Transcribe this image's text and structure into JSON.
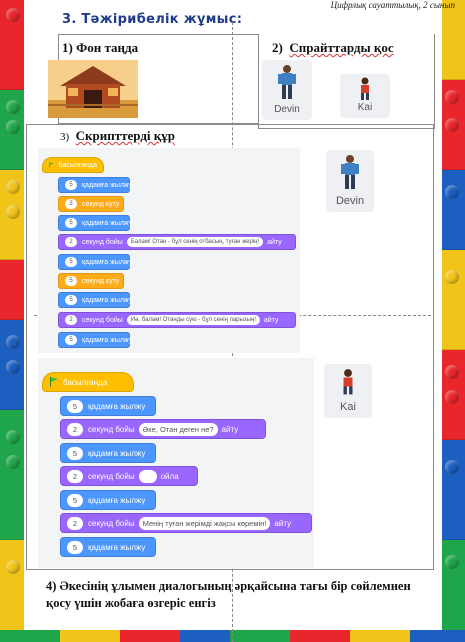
{
  "header_note": "Цифрлық сауаттылық, 2 сынып",
  "section_title": "3. Тәжірибелік жұмыс:",
  "step1": {
    "num": "1)",
    "title": "Фон таңда"
  },
  "step2": {
    "num": "2)",
    "title": "Спрайттарды қос",
    "sprites": [
      "Devin",
      "Kai"
    ]
  },
  "step3": {
    "num": "3)",
    "title": "Скрипттерді құр"
  },
  "script1": {
    "sprite_name": "Devin",
    "hat": "басылғанда",
    "blocks": [
      {
        "color": "blue",
        "num": "5",
        "text": "қадамға жылжу"
      },
      {
        "color": "yellow",
        "num": "3",
        "text": "секунд күту"
      },
      {
        "color": "blue",
        "num": "5",
        "text": "қадамға жылжу"
      },
      {
        "color": "purple",
        "num": "2",
        "pre": "секунд бойы",
        "bubble": "Балам! Отан - бұл сенің отбасың, туған жерің!",
        "post": "айту"
      },
      {
        "color": "blue",
        "num": "5",
        "text": "қадамға жылжу"
      },
      {
        "color": "yellow",
        "num": "5",
        "text": "секунд күту"
      },
      {
        "color": "blue",
        "num": "5",
        "text": "қадамға жылжу"
      },
      {
        "color": "purple",
        "num": "2",
        "pre": "секунд бойы",
        "bubble": "Иә, балам! Отанды сүю - бұл сенің парызың!",
        "post": "айту"
      },
      {
        "color": "blue",
        "num": "5",
        "text": "қадамға жылжу"
      }
    ]
  },
  "script2": {
    "sprite_name": "Kai",
    "hat": "басылғанда",
    "blocks": [
      {
        "color": "blue",
        "num": "5",
        "text": "қадамға жылжу"
      },
      {
        "color": "purple",
        "num": "2",
        "pre": "секунд бойы",
        "bubble": "Әке, Отан деген не?",
        "post": "айту"
      },
      {
        "color": "blue",
        "num": "5",
        "text": "қадамға жылжу"
      },
      {
        "color": "purple",
        "num": "2",
        "pre": "секунд бойы",
        "bubble": "",
        "post": "ойла"
      },
      {
        "color": "blue",
        "num": "5",
        "text": "қадамға жылжу"
      },
      {
        "color": "purple",
        "num": "2",
        "pre": "секунд бойы",
        "bubble": "Менің туған жерімді жақсы көремін!",
        "post": "айту"
      },
      {
        "color": "blue",
        "num": "5",
        "text": "қадамға жылжу"
      }
    ]
  },
  "task4": "4)   Әкесінің ұлымен  диалогының әрқайсына тағы бір сөйлемнен қосу үшін жобаға өзгеріс енгіз",
  "colors": {
    "motion": "#4c97ff",
    "control": "#ffab19",
    "looks": "#9966ff",
    "event": "#ffbf00",
    "title": "#1f3d8a"
  }
}
